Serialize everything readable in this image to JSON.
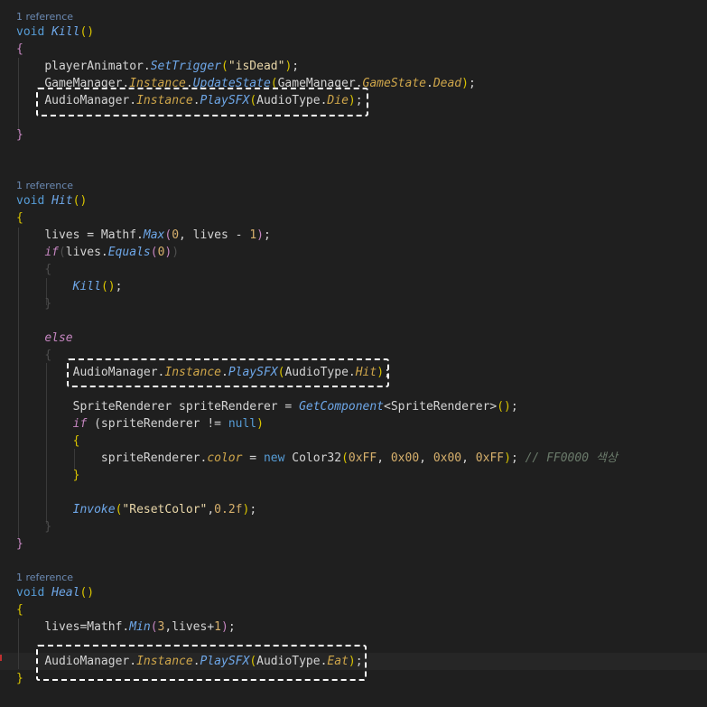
{
  "editor": {
    "codelens": [
      "1 reference",
      "1 reference",
      "1 reference"
    ],
    "kill": {
      "void": "void",
      "name": "Kill",
      "parens": "()",
      "open": "{",
      "close": "}",
      "l1_obj": "playerAnimator.",
      "l1_m": "SetTrigger",
      "l1_o": "(",
      "l1_s": "\"isDead\"",
      "l1_c": ")",
      "l1_end": ";",
      "l2_obj": "GameManager.",
      "l2_p": "Instance",
      "l2_dot": ".",
      "l2_m": "UpdateState",
      "l2_o": "(",
      "l2_arg": "GameManager.",
      "l2_e": "GameState",
      "l2_dot2": ".",
      "l2_v": "Dead",
      "l2_c": ")",
      "l2_end": ";",
      "l3_obj": "AudioManager.",
      "l3_p": "Instance",
      "l3_dot": ".",
      "l3_m": "PlaySFX",
      "l3_o": "(",
      "l3_arg": "AudioType.",
      "l3_v": "Die",
      "l3_c": ")",
      "l3_end": ";"
    },
    "hit": {
      "void": "void",
      "name": "Hit",
      "parens": "()",
      "open": "{",
      "close": "}",
      "l1_a": "lives = Mathf.",
      "l1_m": "Max",
      "l1_o": "(",
      "l1_n0": "0",
      "l1_b": ", lives - ",
      "l1_n1": "1",
      "l1_c": ")",
      "l1_end": ";",
      "if": "if",
      "if_o": "(",
      "if_a": "lives.",
      "if_m": "Equals",
      "if_o2": "(",
      "if_n": "0",
      "if_c2": ")",
      "if_c": ")",
      "b1_open": "{",
      "kill_m": "Kill",
      "kill_p": "()",
      "kill_end": ";",
      "b1_close": "}",
      "else": "else",
      "b2_open": "{",
      "sfx_obj": "AudioManager.",
      "sfx_p": "Instance",
      "sfx_dot": ".",
      "sfx_m": "PlaySFX",
      "sfx_o": "(",
      "sfx_arg": "AudioType.",
      "sfx_v": "Hit",
      "sfx_c": ")",
      "sfx_end": ";",
      "sr_a": "SpriteRenderer spriteRenderer = ",
      "sr_m": "GetComponent",
      "sr_g": "<SpriteRenderer>",
      "sr_p": "()",
      "sr_end": ";",
      "if2": "if",
      "if2_a": " (spriteRenderer != ",
      "if2_null": "null",
      "if2_c": ")",
      "b3_open": "{",
      "col_a": "spriteRenderer.",
      "col_p": "color",
      "col_b": " = ",
      "col_new": "new",
      "col_t": " Color32",
      "col_o": "(",
      "col_n1": "0xFF",
      "col_s1": ", ",
      "col_n2": "0x00",
      "col_s2": ", ",
      "col_n3": "0x00",
      "col_s3": ", ",
      "col_n4": "0xFF",
      "col_c": ")",
      "col_end": ";",
      "col_cmt": " // FF0000 색상",
      "b3_close": "}",
      "inv_m": "Invoke",
      "inv_o": "(",
      "inv_s": "\"ResetColor\"",
      "inv_comma": ",",
      "inv_n": "0.2f",
      "inv_c": ")",
      "inv_end": ";",
      "b2_close": "}"
    },
    "heal": {
      "void": "void",
      "name": "Heal",
      "parens": "()",
      "open": "{",
      "close": "}",
      "l1_a": "lives=Mathf.",
      "l1_m": "Min",
      "l1_o": "(",
      "l1_n3": "3",
      "l1_b": ",lives+",
      "l1_n1": "1",
      "l1_c": ")",
      "l1_end": ";",
      "sfx_obj": "AudioManager.",
      "sfx_p": "Instance",
      "sfx_dot": ".",
      "sfx_m": "PlaySFX",
      "sfx_o": "(",
      "sfx_arg": "AudioType.",
      "sfx_v": "Eat",
      "sfx_c": ")",
      "sfx_end": ";"
    }
  }
}
